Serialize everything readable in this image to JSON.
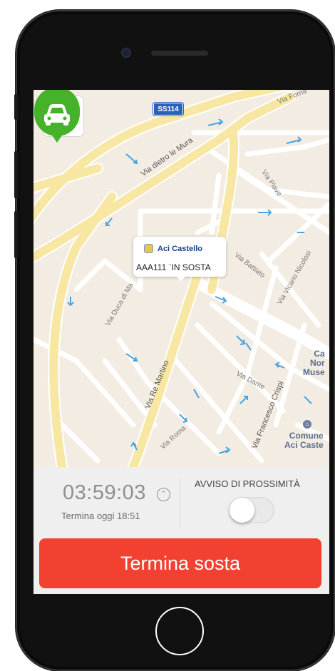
{
  "map": {
    "road_shield": "SS114",
    "street_labels": [
      "Via Forna",
      "Via dietro le Mura",
      "Via Piave",
      "Via Battiato",
      "Via Vicario Nicolosi",
      "Via Duca di Ma",
      "Via Re Martino",
      "Via Dante",
      "Via Francesco Crispi",
      "Via Roma"
    ],
    "poi_partial": [
      "Ca",
      "Nor",
      "Muse"
    ],
    "poi_comune": [
      "Comune",
      "Aci Caste"
    ],
    "callout": {
      "brand": "Aci Castello",
      "plate_status": "AAA111 `IN SOSTA"
    },
    "pin_icon": "car-icon",
    "pin_color": "#46b22a"
  },
  "panel": {
    "timer": "03:59:03",
    "timer_icon": "chevron-up-icon",
    "ends_at": "Termina oggi 18:51",
    "proximity_label": "AVVISO DI PROSSIMITÀ",
    "proximity_enabled": false,
    "end_button": "Termina sosta",
    "end_button_color": "#f24131"
  }
}
